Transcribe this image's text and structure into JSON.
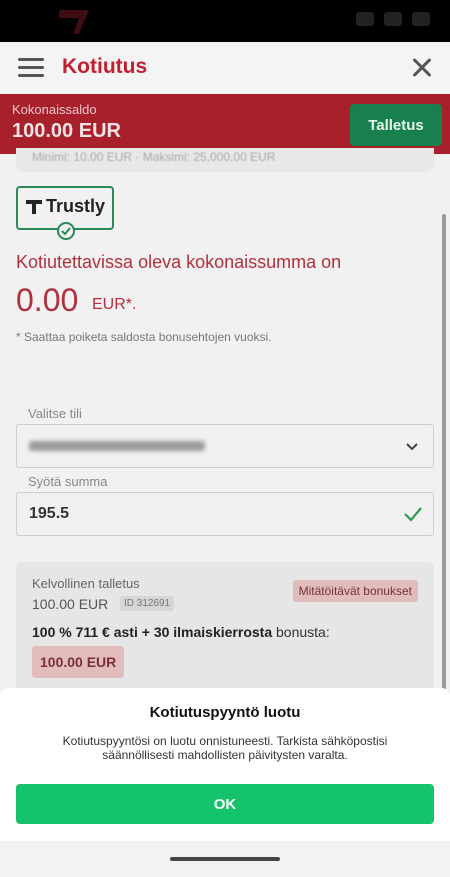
{
  "header": {
    "title": "Kotiutus"
  },
  "balance": {
    "label": "Kokonaissaldo",
    "value": "100.00 EUR",
    "deposit_button": "Talletus"
  },
  "payment_method": {
    "name": "Trustly"
  },
  "withdrawal": {
    "headline": "Kotiutettavissa oleva kokonaissumma on",
    "amount": "0.00",
    "currency": "EUR*.",
    "footnote": "* Saattaa poiketa saldosta bonusehtojen vuoksi."
  },
  "form": {
    "account_label": "Valitse tili",
    "amount_label": "Syötä summa",
    "amount_value": "195.5"
  },
  "bonus": {
    "valid_deposit_label": "Kelvollinen talletus",
    "valid_deposit_amount": "100.00 EUR",
    "deposit_id": "ID 312691",
    "cancel_button": "Mitätöitävät bonukset",
    "offer_bold": "100 % 711 € asti + 30 ilmaiskierrosta",
    "offer_suffix": " bonusta:",
    "bonus_amount": "100.00 EUR"
  },
  "dialog": {
    "title": "Kotiutuspyyntö luotu",
    "body": "Kotiutuspyyntösi on luotu onnistuneesti. Tarkista sähköpostisi säännöllisesti mahdollisten päivitysten varalta.",
    "ok_button": "OK"
  },
  "colors": {
    "brand_red": "#c41d2e",
    "success_green": "#15c36a",
    "deposit_green": "#17804d"
  },
  "icons": {
    "menu": "hamburger-icon",
    "close": "close-icon",
    "select": "chevron-down-icon",
    "valid": "checkmark-icon"
  }
}
